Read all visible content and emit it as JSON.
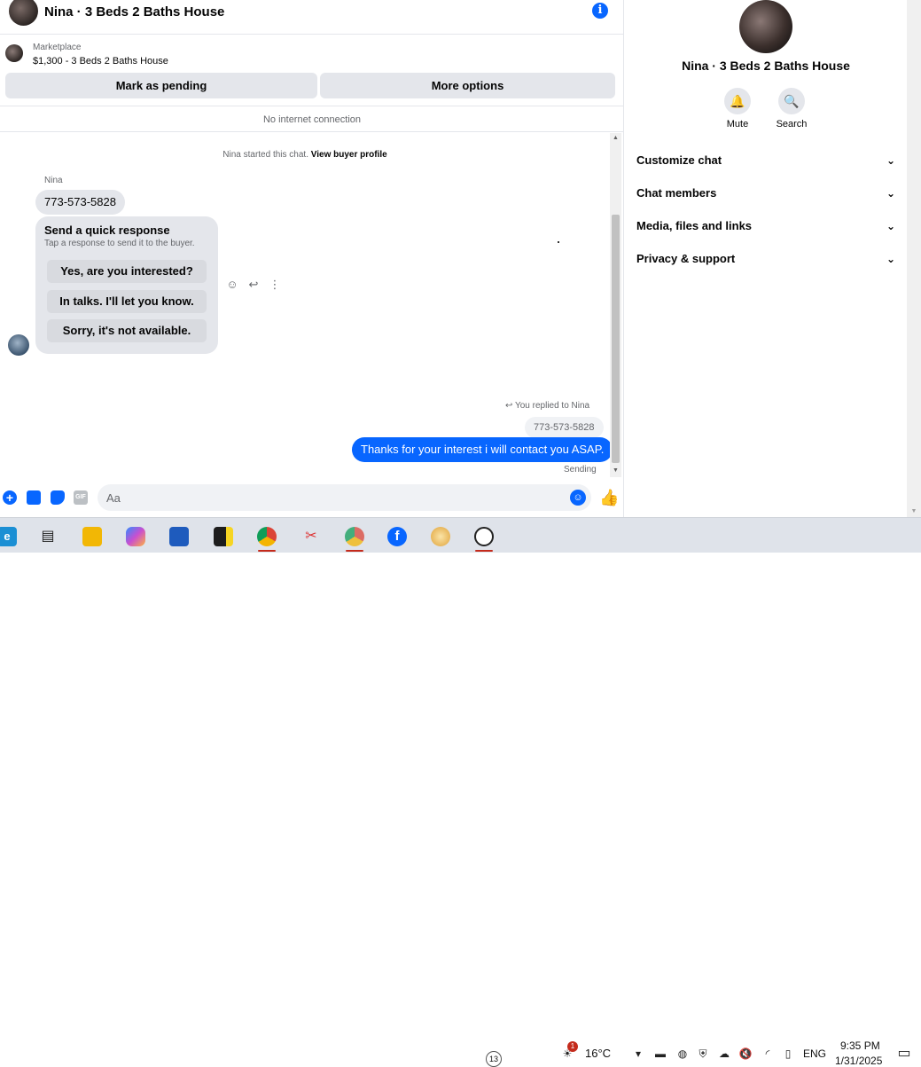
{
  "chat": {
    "title": "Nina · 3 Beds 2 Baths House",
    "info_icon_glyph": "i",
    "marketplace": {
      "label": "Marketplace",
      "listing": "$1,300 - 3 Beds 2 Baths House",
      "mark_pending": "Mark as pending",
      "more_options": "More options"
    },
    "banner": "No internet connection",
    "started_prefix": "Nina started this chat.",
    "started_link": "View buyer profile",
    "sender": "Nina",
    "incoming_message": "773-573-5828",
    "quick_response": {
      "title": "Send a quick response",
      "subtitle": "Tap a response to send it to the buyer.",
      "options": [
        "Yes, are you interested?",
        "In talks. I'll let you know.",
        "Sorry, it's not available."
      ]
    },
    "replied_label": "You replied to Nina",
    "quoted_message": "773-573-5828",
    "outgoing_message": "Thanks for your interest i will contact you ASAP.",
    "status": "Sending",
    "composer_placeholder": "Aa",
    "accent_color": "#0866ff"
  },
  "side": {
    "name": "Nina · 3 Beds 2 Baths House",
    "actions": [
      {
        "label": "Mute",
        "icon": "bell-icon"
      },
      {
        "label": "Search",
        "icon": "search-icon"
      }
    ],
    "rows": [
      "Customize chat",
      "Chat members",
      "Media, files and links",
      "Privacy & support"
    ]
  },
  "taskbar": {
    "weather": "16°C",
    "weather_badge": "1",
    "whatsapp_badge": "13",
    "language": "ENG",
    "time": "9:35 PM",
    "date": "1/31/2025"
  }
}
